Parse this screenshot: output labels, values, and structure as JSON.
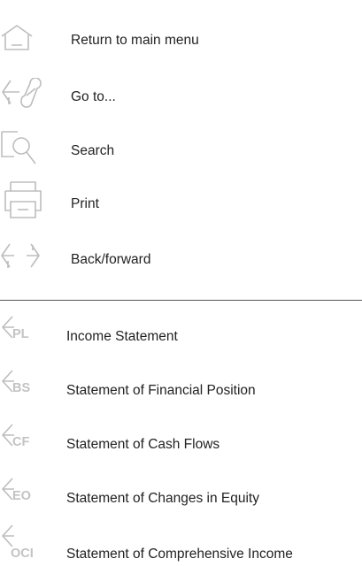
{
  "nav": {
    "home": "Return to main menu",
    "goto": "Go to...",
    "search": "Search",
    "print": "Print",
    "backforward": "Back/forward"
  },
  "statements": [
    {
      "code": "PL",
      "label": "Income Statement"
    },
    {
      "code": "BS",
      "label": "Statement of Financial Position"
    },
    {
      "code": "CF",
      "label": "Statement of Cash Flows"
    },
    {
      "code": "EO",
      "label": "Statement of Changes in Equity"
    },
    {
      "code": "OCI",
      "label": "Statement of Comprehensive Income"
    }
  ],
  "colors": {
    "icon": "#bdbdbd",
    "text": "#222222",
    "divider": "#555555"
  }
}
